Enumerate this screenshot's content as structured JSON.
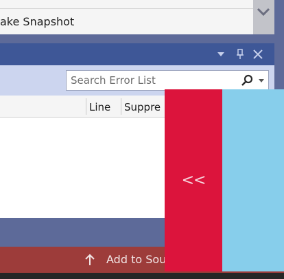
{
  "snapshot_dropdown": {
    "label": "ake Snapshot",
    "chevron_icon": "chevron-down-icon"
  },
  "tool_window": {
    "header_icons": [
      "dropdown-arrow-icon",
      "pin-icon",
      "close-icon"
    ]
  },
  "error_list": {
    "search": {
      "placeholder": "Search Error List",
      "icon": "search-icon"
    },
    "columns": [
      "Line",
      "Suppre"
    ]
  },
  "status_bar": {
    "action_label": "Add to Sou",
    "icon": "arrow-up-icon"
  },
  "overlay": {
    "collapse_glyph": "<<"
  },
  "colors": {
    "header": "#3e5797",
    "toolbar": "#ccd5ef",
    "status_bar": "#9d3c3a",
    "collapse_panel": "#dc143c",
    "side_panel": "#87ceeb"
  }
}
